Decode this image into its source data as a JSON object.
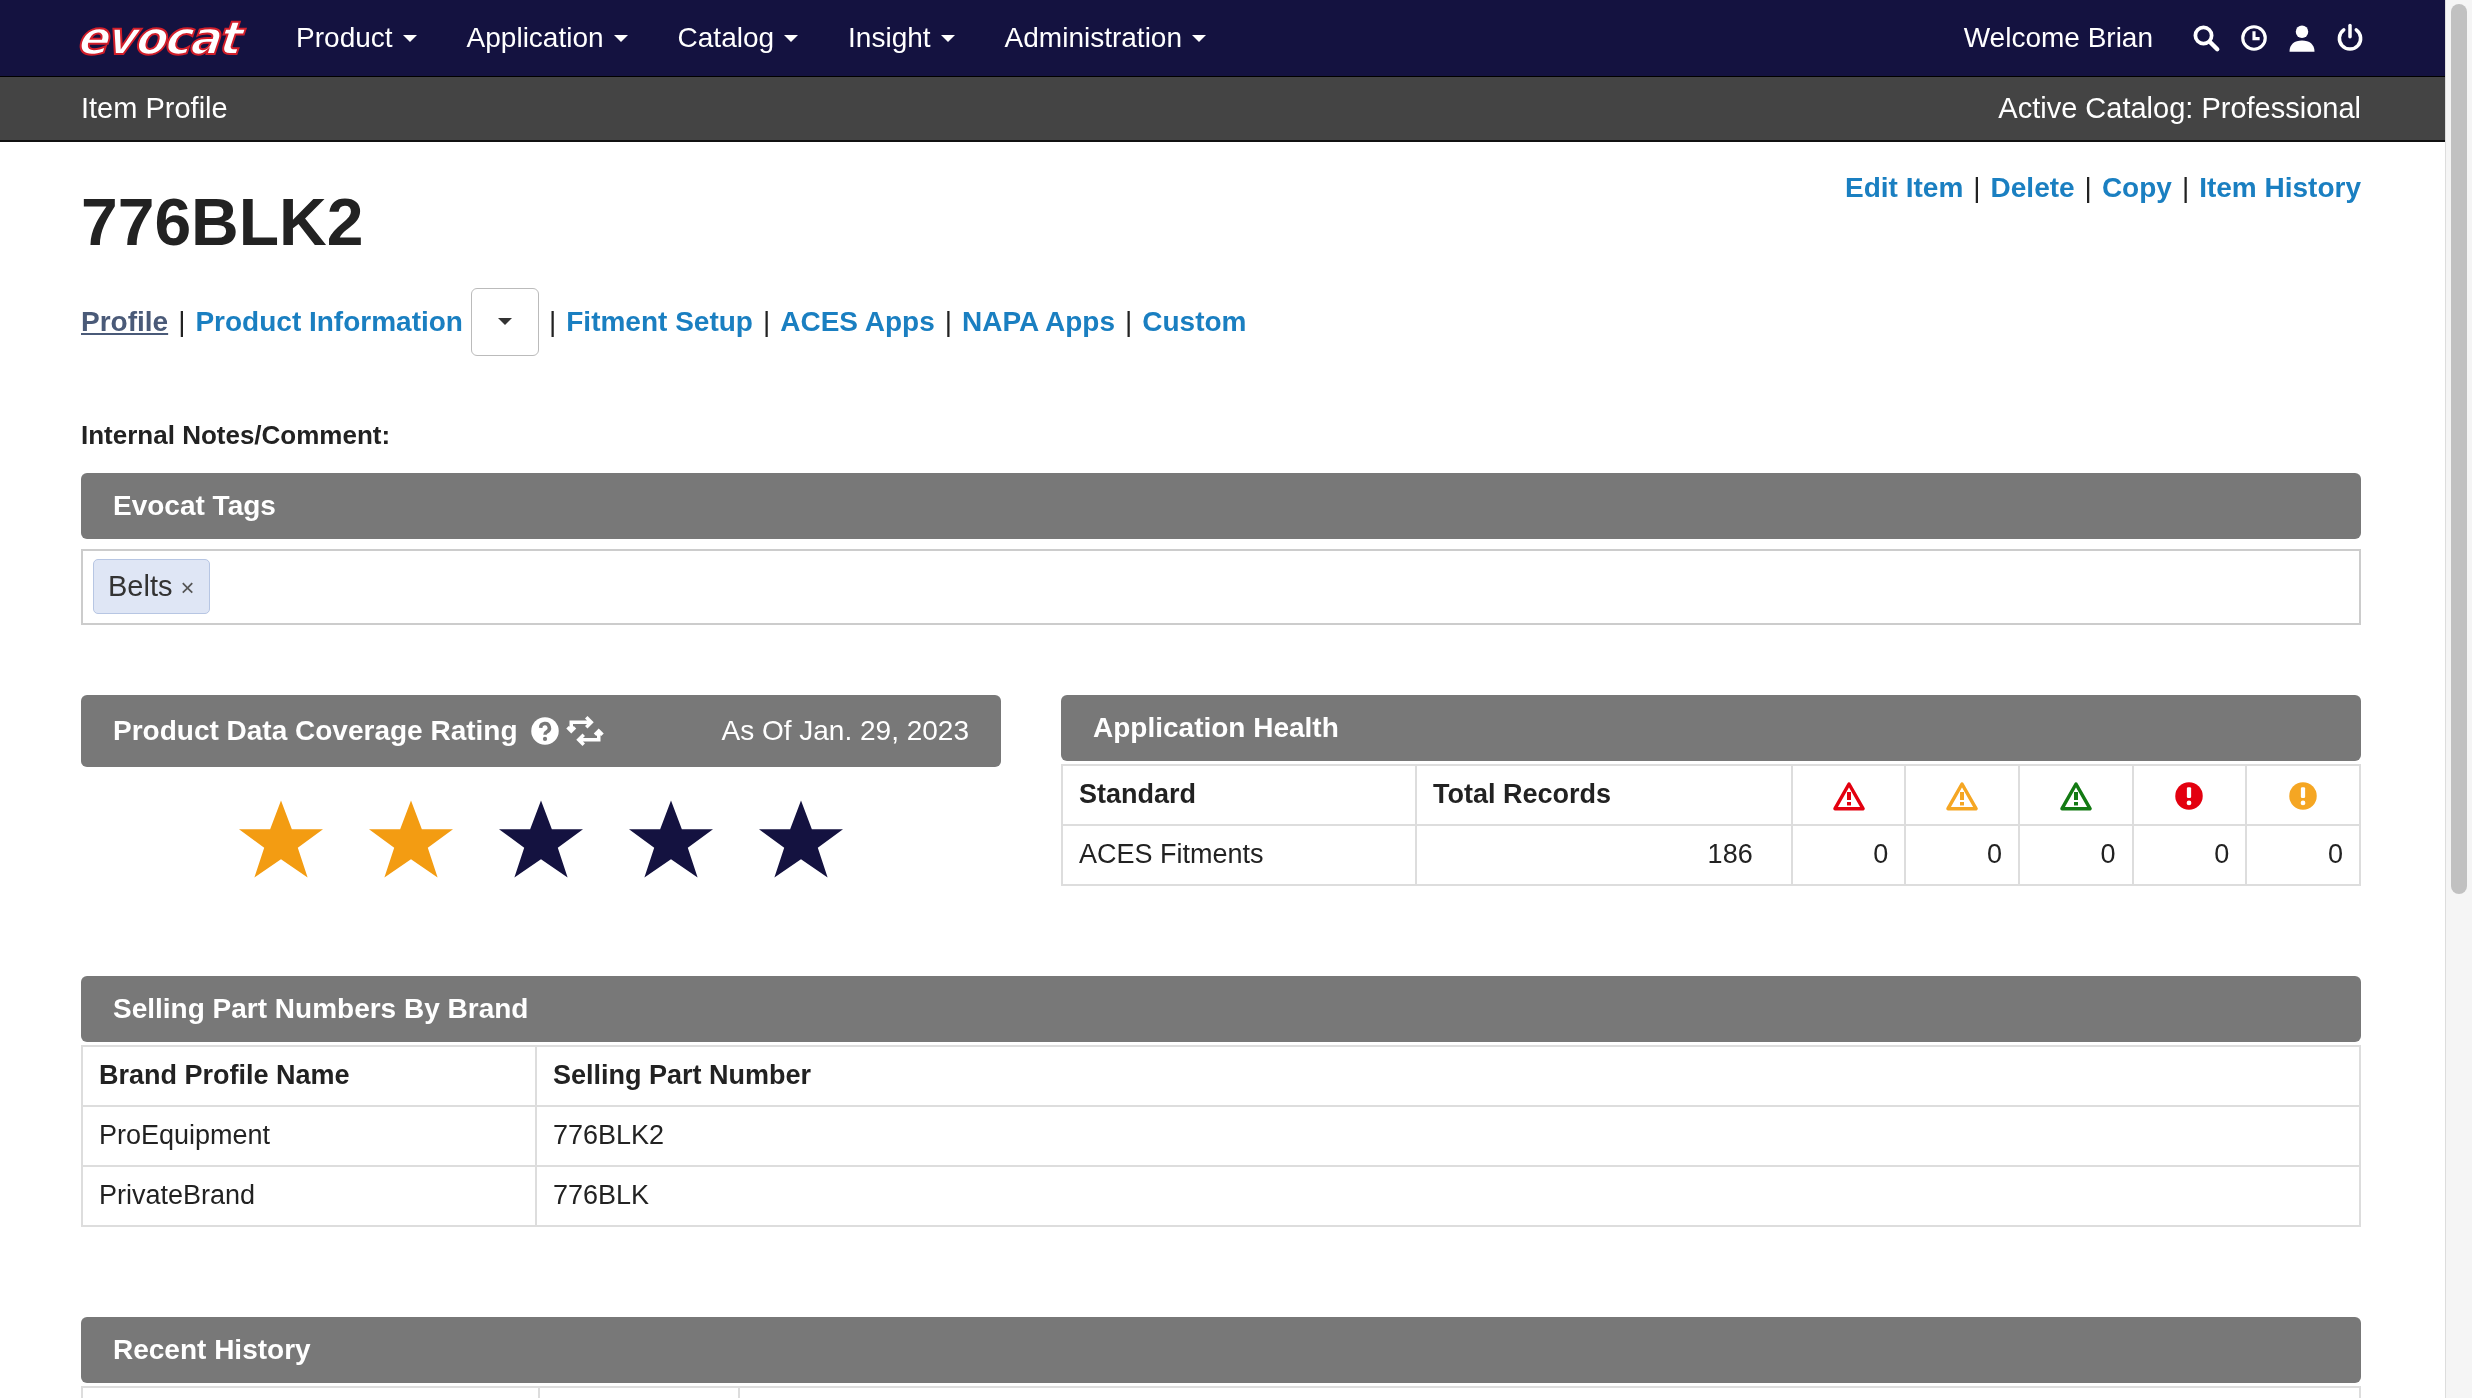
{
  "nav": {
    "logo": "evocat",
    "menus": [
      {
        "label": "Product"
      },
      {
        "label": "Application"
      },
      {
        "label": "Catalog"
      },
      {
        "label": "Insight"
      },
      {
        "label": "Administration"
      }
    ],
    "welcome": "Welcome Brian"
  },
  "subbar": {
    "title": "Item Profile",
    "catalog": "Active Catalog: Professional"
  },
  "item": {
    "title": "776BLK2",
    "actions": [
      "Edit Item",
      "Delete",
      "Copy",
      "Item History"
    ]
  },
  "separator": "|",
  "tabs": [
    {
      "label": "Profile",
      "selected": true,
      "has_dropdown": false
    },
    {
      "label": "Product Information",
      "selected": false,
      "has_dropdown": true
    },
    {
      "label": "Fitment Setup",
      "selected": false,
      "has_dropdown": false
    },
    {
      "label": "ACES Apps",
      "selected": false,
      "has_dropdown": false
    },
    {
      "label": "NAPA Apps",
      "selected": false,
      "has_dropdown": false
    },
    {
      "label": "Custom",
      "selected": false,
      "has_dropdown": false
    }
  ],
  "notes_label": "Internal Notes/Comment:",
  "tags_panel": {
    "title": "Evocat Tags",
    "tags": [
      {
        "label": "Belts",
        "remove": "×"
      }
    ]
  },
  "coverage": {
    "title": "Product Data Coverage Rating",
    "as_of": "As Of Jan. 29, 2023",
    "stars": 2
  },
  "health": {
    "title": "Application Health",
    "columns": [
      {
        "kind": "text",
        "label": "Standard"
      },
      {
        "kind": "text",
        "label": "Total Records"
      },
      {
        "kind": "triangle",
        "color": "#e3000f"
      },
      {
        "kind": "triangle",
        "color": "#f5a623"
      },
      {
        "kind": "triangle",
        "color": "#137a13"
      },
      {
        "kind": "circle",
        "color": "#e3000f"
      },
      {
        "kind": "circle",
        "color": "#f5a623"
      }
    ],
    "rows": [
      [
        "ACES Fitments",
        "186",
        "0",
        "0",
        "0",
        "0",
        "0"
      ]
    ]
  },
  "selling": {
    "title": "Selling Part Numbers By Brand",
    "columns": [
      "Brand Profile Name",
      "Selling Part Number"
    ],
    "rows": [
      [
        "ProEquipment",
        "776BLK2"
      ],
      [
        "PrivateBrand",
        "776BLK"
      ]
    ]
  },
  "history": {
    "title": "Recent History"
  }
}
